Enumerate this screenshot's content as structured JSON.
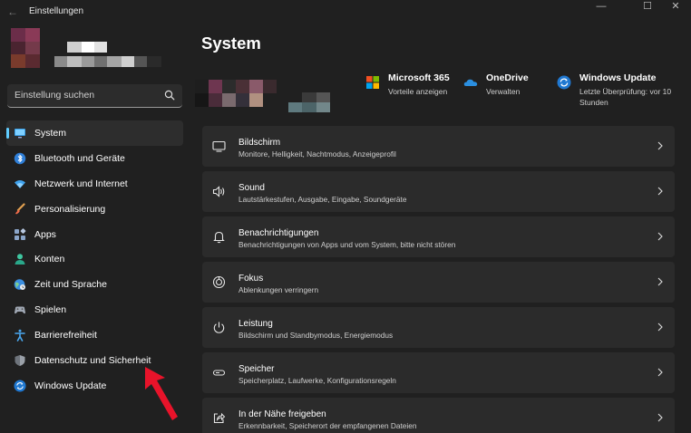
{
  "window": {
    "title": "Einstellungen",
    "back_glyph": "←",
    "minimize_glyph": "—",
    "maximize_glyph": "☐",
    "close_glyph": "✕"
  },
  "search": {
    "placeholder": "Einstellung suchen"
  },
  "sidebar": {
    "items": [
      {
        "label": "System",
        "icon": "monitor-icon",
        "active": true
      },
      {
        "label": "Bluetooth und Geräte",
        "icon": "bluetooth-icon"
      },
      {
        "label": "Netzwerk und Internet",
        "icon": "wifi-icon"
      },
      {
        "label": "Personalisierung",
        "icon": "brush-icon"
      },
      {
        "label": "Apps",
        "icon": "apps-icon"
      },
      {
        "label": "Konten",
        "icon": "person-icon"
      },
      {
        "label": "Zeit und Sprache",
        "icon": "globe-clock-icon"
      },
      {
        "label": "Spielen",
        "icon": "gamepad-icon"
      },
      {
        "label": "Barrierefreiheit",
        "icon": "accessibility-icon"
      },
      {
        "label": "Datenschutz und Sicherheit",
        "icon": "shield-icon"
      },
      {
        "label": "Windows Update",
        "icon": "sync-icon"
      }
    ]
  },
  "main": {
    "title": "System",
    "quick_links": [
      {
        "title": "Microsoft 365",
        "subtitle": "Vorteile anzeigen",
        "icon": "microsoft-logo-icon"
      },
      {
        "title": "OneDrive",
        "subtitle": "Verwalten",
        "icon": "cloud-icon"
      },
      {
        "title": "Windows Update",
        "subtitle_line1": "Letzte Überprüfung: vor 10",
        "subtitle_line2": "Stunden",
        "icon": "update-icon"
      }
    ],
    "cards": [
      {
        "title": "Bildschirm",
        "subtitle": "Monitore, Helligkeit, Nachtmodus, Anzeigeprofil",
        "icon": "display-icon"
      },
      {
        "title": "Sound",
        "subtitle": "Lautstärkestufen, Ausgabe, Eingabe, Soundgeräte",
        "icon": "speaker-icon"
      },
      {
        "title": "Benachrichtigungen",
        "subtitle": "Benachrichtigungen von Apps und vom System, bitte nicht stören",
        "icon": "bell-icon"
      },
      {
        "title": "Fokus",
        "subtitle": "Ablenkungen verringern",
        "icon": "focus-icon"
      },
      {
        "title": "Leistung",
        "subtitle": "Bildschirm und Standbymodus, Energiemodus",
        "icon": "power-icon"
      },
      {
        "title": "Speicher",
        "subtitle": "Speicherplatz, Laufwerke, Konfigurationsregeln",
        "icon": "storage-icon"
      },
      {
        "title": "In der Nähe freigeben",
        "subtitle": "Erkennbarkeit, Speicherort der empfangenen Dateien",
        "icon": "share-icon"
      }
    ]
  },
  "colors": {
    "background": "#202020",
    "card": "#2b2b2b",
    "accent": "#60cdff",
    "annotation_arrow": "#e8132a"
  }
}
